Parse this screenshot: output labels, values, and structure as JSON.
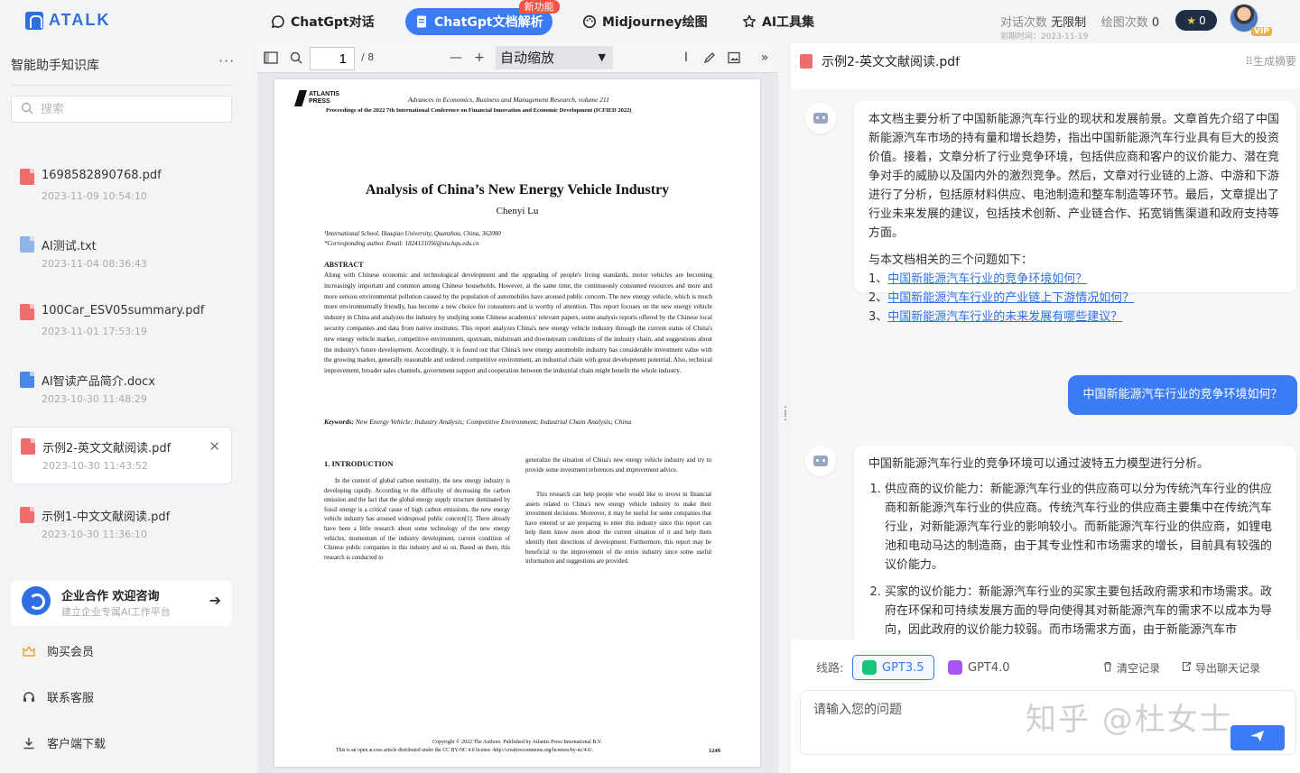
{
  "app": {
    "logo_text": "ATALK"
  },
  "nav": {
    "items": [
      {
        "label": "ChatGpt对话",
        "icon": "chat-bubble-icon"
      },
      {
        "label": "ChatGpt文档解析",
        "icon": "document-icon",
        "badge": "新功能"
      },
      {
        "label": "Midjourney绘图",
        "icon": "palette-icon"
      },
      {
        "label": "AI工具集",
        "icon": "star-icon"
      }
    ]
  },
  "account": {
    "chat_quota_label": "对话次数",
    "chat_quota_value": "无限制",
    "draw_quota_label": "绘图次数",
    "draw_quota_value": "0",
    "expiry": "到期时间：2023-11-19",
    "stars": "0",
    "vip": "VIP"
  },
  "sidebar": {
    "title": "智能助手知识库",
    "more": "···",
    "search_placeholder": "搜索",
    "files": [
      {
        "name": "1698582890768.pdf",
        "date": "2023-11-09 10:54:10",
        "type": "pdf"
      },
      {
        "name": "AI测试.txt",
        "date": "2023-11-04 08:36:43",
        "type": "txt"
      },
      {
        "name": "100Car_ESV05summary.pdf",
        "date": "2023-11-01 17:53:19",
        "type": "pdf"
      },
      {
        "name": "AI智读产品简介.docx",
        "date": "2023-10-30 11:48:29",
        "type": "doc"
      },
      {
        "name": "示例2-英文文献阅读.pdf",
        "date": "2023-10-30 11:43:52",
        "type": "pdf",
        "active": true
      },
      {
        "name": "示例1-中文文献阅读.pdf",
        "date": "2023-10-30 11:36:10",
        "type": "pdf"
      }
    ],
    "promo": {
      "title": "企业合作 欢迎咨询",
      "subtitle": "建立企业专属AI工作平台"
    },
    "links": [
      {
        "label": "购买会员",
        "icon": "crown-icon"
      },
      {
        "label": "联系客服",
        "icon": "headset-icon"
      },
      {
        "label": "客户端下载",
        "icon": "download-icon"
      }
    ]
  },
  "viewer": {
    "page_current": "1",
    "page_total": "/ 8",
    "zoom": "自动缩放",
    "doc": {
      "publisher": "ATLANTIS\nPRESS",
      "header1": "Advances in Economics, Business and Management Research, volume 211",
      "header2": "Proceedings of the 2022 7th International Conference on Financial Innovation and Economic Development (ICFIED 2022)",
      "title": "Analysis of China’s New Energy Vehicle Industry",
      "author": "Chenyi Lu",
      "affiliation1": "¹International School, Huaqiao University, Quanzhou, China, 362000",
      "affiliation2": "*Corresponding author. Email: 1824131056@stu.hqu.edu.cn",
      "abstract_heading": "ABSTRACT",
      "abstract": "Along with Chinese economic and technological development and the upgrading of people's living standards, motor vehicles are becoming increasingly important and common among Chinese households. However, at the same time, the continuously consumed resources and more and more serious environmental pollution caused by the population of automobiles have aroused public concern. The new energy vehicle, which is much more environmentally friendly, has become a new choice for consumers and is worthy of attention. This report focuses on the new energy vehicle industry in China and analyzes the industry by studying some Chinese academics' relevant papers, some analysis reports offered by the Chinese local security companies and data from native institutes. This report analyzes China's new energy vehicle industry through the current status of China's new energy vehicle market, competitive environment, upstream, midstream and downstream conditions of the industry chain, and suggestions about the industry's future development. Accordingly, it is found out that China's new energy automobile industry has considerable investment value with the growing market, generally reasonable and ordered competitive environment, an industrial chain with great development potential. Also, technical improvement, broader sales channels, government support and cooperation between the industrial chain might benefit the whole industry.",
      "keywords_label": "Keywords:",
      "keywords": "New Energy Vehicle; Industry Analysis; Competitive Environment; Industrial Chain Analysis; China",
      "intro_heading": "1. INTRODUCTION",
      "intro_col1": "In the context of global carbon neutrality, the new energy industry is developing rapidly. According to the difficulty of decreasing the carbon emission and the fact that the global energy supply structure dominated by fossil energy is a critical cause of high carbon emissions, the new energy vehicle industry has aroused widespread public concern[1]. There already have been a little research about some technology of the new energy vehicles, momentum of the industry development, current condition of Chinese public companies in this industry and so on. Based on them, this research is conducted to",
      "intro_col2a": "generalize the situation of China's new energy vehicle industry and try to provide some investment references and improvement advice.",
      "intro_col2b": "This research can help people who would like to invest in financial assets related to China's new energy vehicle industry to make their investment decisions. Moreover, it may be useful for some companies that have entered or are preparing to enter this industry since this report can help them know more about the current situation of it and help them identify their directions of development. Furthermore, this report may be beneficial to the improvement of the entire industry since some useful information and suggestions are provided.",
      "footer1": "Copyright © 2022 The Authors. Published by Atlantis Press International B.V.",
      "footer2": "This is an open access article distributed under the CC BY-NC 4.0 license -http://creativecommons.org/licenses/by-nc/4.0/.",
      "page_number": "1249"
    }
  },
  "chat": {
    "file_name": "示例2-英文文献阅读.pdf",
    "gen_summary": "⠿生成摘要",
    "summary": "本文档主要分析了中国新能源汽车行业的现状和发展前景。文章首先介绍了中国新能源汽车市场的持有量和增长趋势，指出中国新能源汽车行业具有巨大的投资价值。接着，文章分析了行业竞争环境，包括供应商和客户的议价能力、潜在竞争对手的威胁以及国内外的激烈竞争。然后，文章对行业链的上游、中游和下游进行了分析，包括原材料供应、电池制造和整车制造等环节。最后，文章提出了行业未来发展的建议，包括技术创新、产业链合作、拓宽销售渠道和政府支持等方面。",
    "questions_intro": "与本文档相关的三个问题如下：",
    "questions": [
      {
        "num": "1、",
        "text": "中国新能源汽车行业的竞争环境如何？"
      },
      {
        "num": "2、",
        "text": "中国新能源汽车行业的产业链上下游情况如何？"
      },
      {
        "num": "3、",
        "text": "中国新能源汽车行业的未来发展有哪些建议？"
      }
    ],
    "user_message": "中国新能源汽车行业的竞争环境如何？",
    "answer_intro": "中国新能源汽车行业的竞争环境可以通过波特五力模型进行分析。",
    "answer_points": [
      "供应商的议价能力：新能源汽车行业的供应商可以分为传统汽车行业的供应商和新能源汽车行业的供应商。传统汽车行业的供应商主要集中在传统汽车行业，对新能源汽车行业的影响较小。而新能源汽车行业的供应商，如锂电池和电动马达的制造商，由于其专业性和市场需求的增长，目前具有较强的议价能力。",
      "买家的议价能力：新能源汽车行业的买家主要包括政府需求和市场需求。政府在环保和可持续发展方面的导向使得其对新能源汽车的需求不以成本为导向，因此政府的议价能力较弱。而市场需求方面，由于新能源汽车市"
    ],
    "route_label": "线路:",
    "models": [
      {
        "label": "GPT3.5",
        "active": true
      },
      {
        "label": "GPT4.0",
        "active": false
      }
    ],
    "clear_label": "清空记录",
    "export_label": "导出聊天记录",
    "input_placeholder": "请输入您的问题",
    "watermark": "知乎 @杜女士"
  }
}
